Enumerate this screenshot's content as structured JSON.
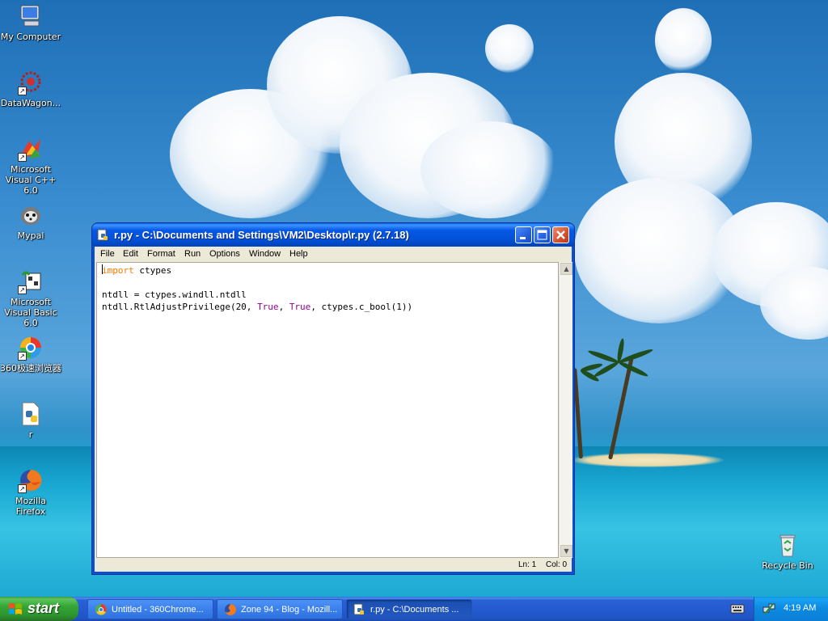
{
  "desktop": {
    "icons": [
      {
        "label": "My Computer",
        "icon": "my-computer-icon"
      },
      {
        "label": "DataWagon...",
        "icon": "datawagon-icon"
      },
      {
        "label": "Microsoft Visual C++ 6.0",
        "icon": "visual-cpp-icon"
      },
      {
        "label": "Mypal",
        "icon": "mypal-icon"
      },
      {
        "label": "Microsoft Visual Basic 6.0",
        "icon": "visual-basic-icon"
      },
      {
        "label": "360极速浏览器",
        "icon": "360-browser-icon"
      },
      {
        "label": "r",
        "icon": "python-file-icon"
      },
      {
        "label": "Mozilla Firefox",
        "icon": "firefox-icon"
      }
    ],
    "recycle_bin": {
      "label": "Recycle Bin",
      "icon": "recycle-bin-icon"
    }
  },
  "window": {
    "title": "r.py - C:\\Documents and Settings\\VM2\\Desktop\\r.py (2.7.18)",
    "menu": [
      "File",
      "Edit",
      "Format",
      "Run",
      "Options",
      "Window",
      "Help"
    ],
    "code": {
      "line1_kw": "import",
      "line1_rest": " ctypes",
      "line3": "ntdll = ctypes.windll.ntdll",
      "line4_a": "ntdll.RtlAdjustPrivilege(20, ",
      "line4_true1": "True",
      "line4_b": ", ",
      "line4_true2": "True",
      "line4_c": ", ctypes.c_bool(1))"
    },
    "status": {
      "ln": "Ln: 1",
      "col": "Col: 0"
    }
  },
  "taskbar": {
    "start_label": "start",
    "tasks": [
      {
        "label": "Untitled - 360Chrome...",
        "icon": "360chrome-icon",
        "active": false
      },
      {
        "label": "Zone 94 - Blog - Mozill...",
        "icon": "firefox-icon",
        "active": false
      },
      {
        "label": "r.py - C:\\Documents ...",
        "icon": "python-idle-icon",
        "active": true
      }
    ],
    "clock": "4:19 AM"
  },
  "colors": {
    "keyword": "#ff7700",
    "builtin": "#900090",
    "title_bar": "#0758e6",
    "start_green": "#34a534"
  }
}
